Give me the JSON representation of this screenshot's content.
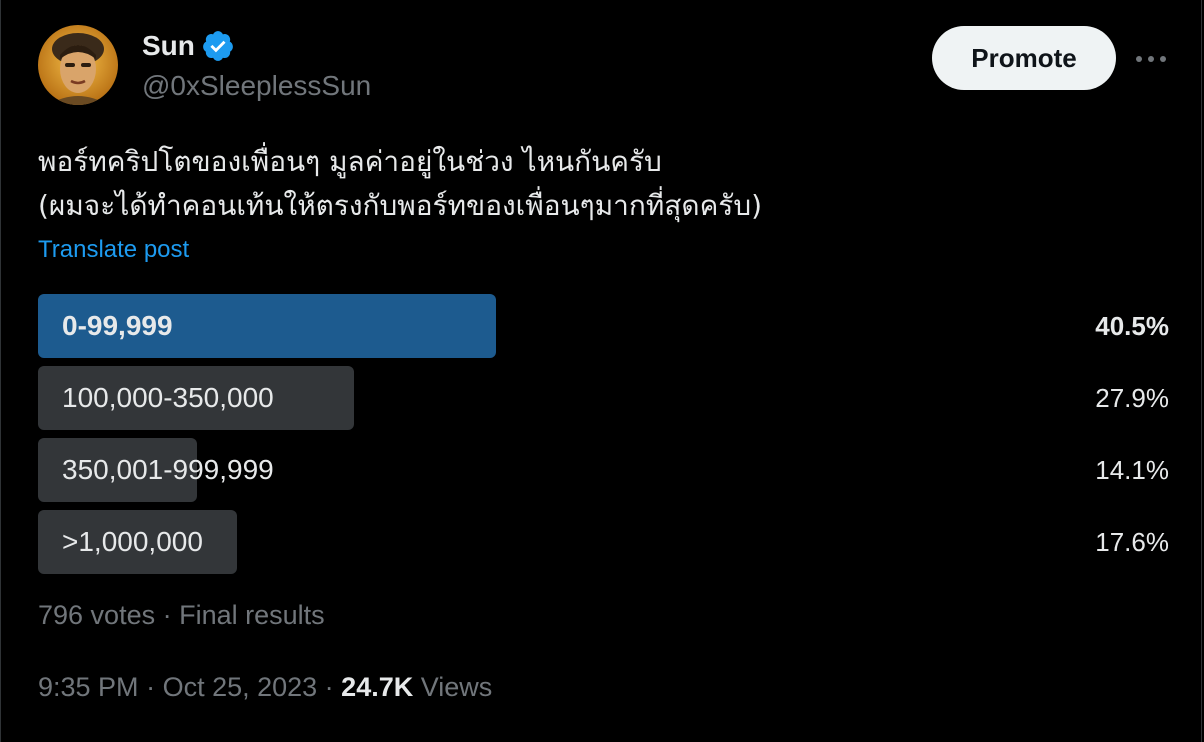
{
  "author": {
    "display_name": "Sun",
    "handle": "@0xSleeplessSun",
    "verified": true
  },
  "actions": {
    "promote_label": "Promote"
  },
  "post": {
    "lines": [
      "พอร์ทคริปโตของเพื่อนๆ มูลค่าอยู่ในช่วง ไหนกันครับ",
      "(ผมจะได้ทำคอนเท้นให้ตรงกับพอร์ทของเพื่อนๆมากที่สุดครับ)"
    ],
    "translate_label": "Translate post"
  },
  "poll": {
    "options": [
      {
        "label": "0-99,999",
        "percent_text": "40.5%",
        "percent": 40.5,
        "winner": true
      },
      {
        "label": "100,000-350,000",
        "percent_text": "27.9%",
        "percent": 27.9,
        "winner": false
      },
      {
        "label": "350,001-999,999",
        "percent_text": "14.1%",
        "percent": 14.1,
        "winner": false
      },
      {
        "label": ">1,000,000",
        "percent_text": "17.6%",
        "percent": 17.6,
        "winner": false
      }
    ],
    "votes_text": "796 votes",
    "separator": " · ",
    "status_text": "Final results"
  },
  "meta": {
    "time": "9:35 PM",
    "date": "Oct 25, 2023",
    "separator": " · ",
    "views_count": "24.7K",
    "views_label": "Views"
  },
  "colors": {
    "background": "#000000",
    "accent": "#1d9bf0",
    "winner_bar": "#1d5b8f",
    "option_bar": "#333639",
    "muted_text": "#71767b"
  }
}
